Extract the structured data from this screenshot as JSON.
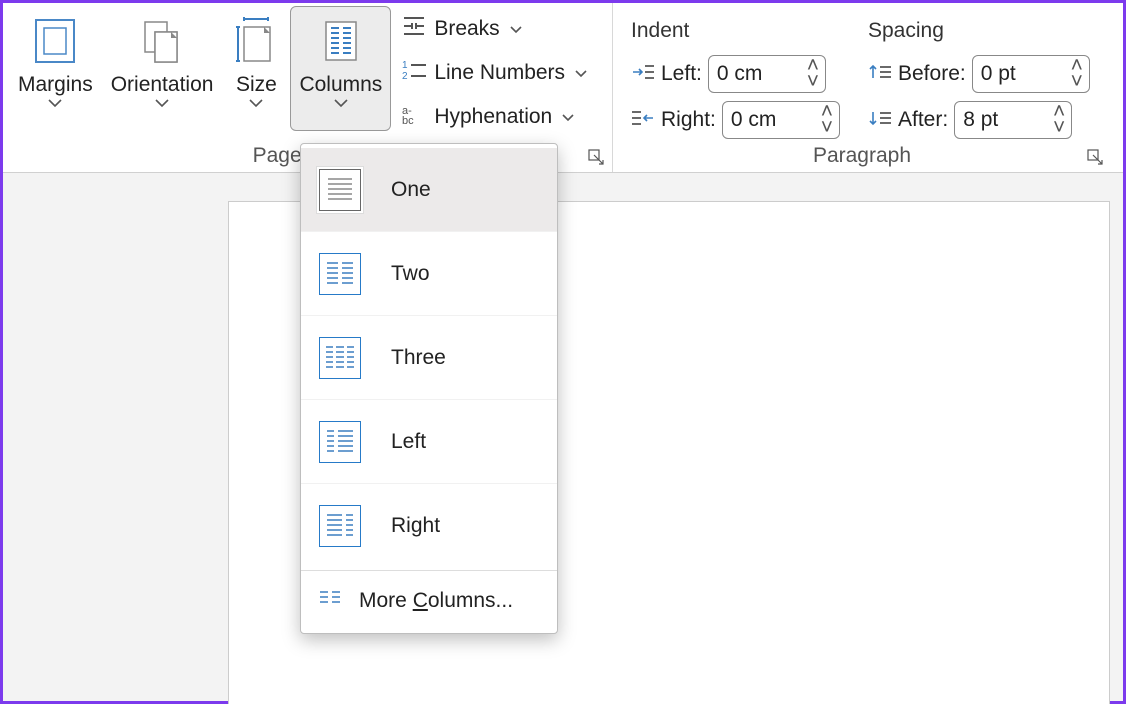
{
  "ribbon": {
    "page_setup": {
      "label": "Page Setup",
      "margins": "Margins",
      "orientation": "Orientation",
      "size": "Size",
      "columns": "Columns",
      "breaks": "Breaks",
      "line_numbers": "Line Numbers",
      "hyphenation": "Hyphenation"
    },
    "paragraph": {
      "label": "Paragraph",
      "indent_label": "Indent",
      "spacing_label": "Spacing",
      "left_label": "Left:",
      "right_label": "Right:",
      "before_label": "Before:",
      "after_label": "After:",
      "left_value": "0 cm",
      "right_value": "0 cm",
      "before_value": "0 pt",
      "after_value": "8 pt"
    }
  },
  "columns_menu": {
    "one": "One",
    "two": "Two",
    "three": "Three",
    "left": "Left",
    "right": "Right",
    "more_prefix": "More ",
    "more_letter": "C",
    "more_suffix": "olumns..."
  }
}
